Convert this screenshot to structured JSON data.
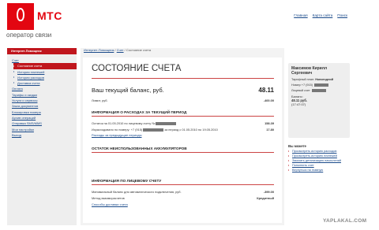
{
  "brand": {
    "logo_text": "МТС",
    "tagline": "оператор связи",
    "accent": "#e30611"
  },
  "toplinks": [
    "Главная",
    "Карта сайта",
    "Поиск"
  ],
  "sidebar": {
    "header": "Интернет-Помощник",
    "items": [
      {
        "label": "Счет",
        "sub": false,
        "active": false
      },
      {
        "label": "Состояние счета",
        "sub": true,
        "active": true
      },
      {
        "label": "История платежей",
        "sub": true,
        "active": false
      },
      {
        "label": "История расходов",
        "sub": true,
        "active": false
      },
      {
        "label": "Доставка счета",
        "sub": true,
        "active": false
      },
      {
        "label": "Оплата",
        "sub": false,
        "active": false
      },
      {
        "label": "Тарифы и скидки",
        "sub": false,
        "active": false
      },
      {
        "label": "Услуги и сервисы",
        "sub": false,
        "active": false
      },
      {
        "label": "Заказ документов",
        "sub": false,
        "active": false
      },
      {
        "label": "Блокировка номера",
        "sub": false,
        "active": false
      },
      {
        "label": "Архив операций",
        "sub": false,
        "active": false
      },
      {
        "label": "Отправка SMS/MMS",
        "sub": false,
        "active": false
      },
      {
        "label": "Мои настройки",
        "sub": false,
        "active": false
      },
      {
        "label": "Выход",
        "sub": false,
        "active": false
      }
    ]
  },
  "breadcrumb": {
    "home": "Интернет-Помощник",
    "sep1": " / ",
    "acct": "Счет",
    "sep2": " / ",
    "current": "Состояние счета"
  },
  "main": {
    "title": "СОСТОЯНИЕ СЧЕТА",
    "balance_label": "Ваш текущий баланс, руб.",
    "balance_value": "48.11",
    "limit_label": "Лимит, руб.",
    "limit_value": "-400.00",
    "sec1": "ИНФОРМАЦИЯ О РАСХОДАХ ЗА ТЕКУЩИЙ ПЕРИОД",
    "sec1_row1_label": "Остаток на 01.05.2010 по лицевому счету №",
    "sec1_row1_value": "158.39",
    "sec1_row2_label": "Израсходовано по номеру: +7 (915)",
    "sec1_row2_period": "за период с 01.05.2010 по 19.05.2010",
    "sec1_row2_value": "17.80",
    "sec1_link": "Расходы за предыдущие периоды",
    "sec2": "ОСТАТОК НЕИСПОЛЬЗОВАННЫХ АККУМУЛЯТОРОВ",
    "sec3": "ИНФОРМАЦИЯ ПО ЛИЦЕВОМУ СЧЕТУ",
    "sec3_row1_label": "Минимальный баланс для автоматического подключения, руб.",
    "sec3_row1_value": "-399.00",
    "sec3_row2_label": "Метод взаиморасчетов",
    "sec3_row2_value": "Кредитный",
    "sec3_link": "Способы доставки счета"
  },
  "user": {
    "name": "Максимов Кирилл Сергеевич",
    "tariff_label": "Тарифный план:",
    "tariff_value": "Новогодний",
    "number_label": "Номер +7 (915)",
    "account_label": "Лицевой счет",
    "balance_label": "Баланс:",
    "balance_value": "48.11 руб.",
    "balance_time": "(17:47:07)"
  },
  "you_can": {
    "title": "Вы можете",
    "links": [
      "Просмотреть историю расходов",
      "Просмотреть историю платежей",
      "Заказать детализацию начислений",
      "Пополнить счет",
      "Вернуться на главную"
    ]
  },
  "watermark": "YAPLAKAL.COM"
}
